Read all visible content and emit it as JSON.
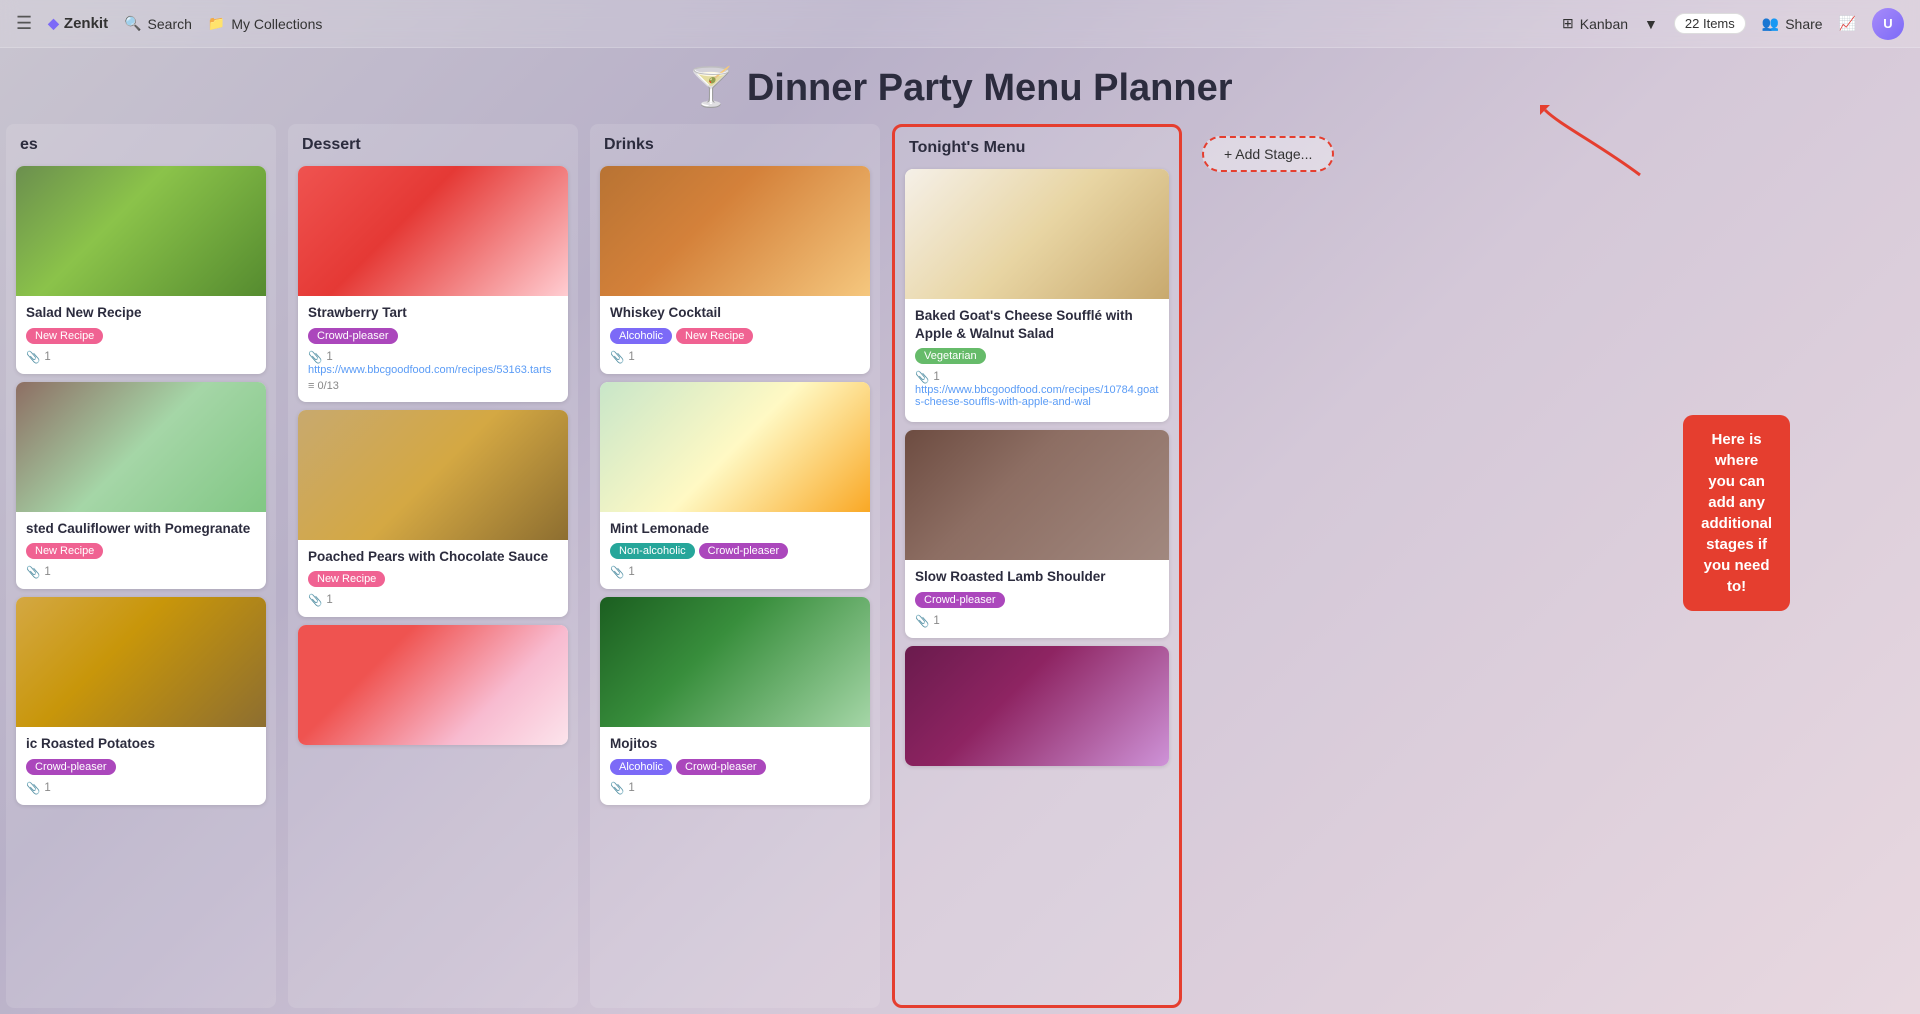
{
  "app": {
    "name": "Zenkit",
    "logo_icon": "◆"
  },
  "topnav": {
    "hamburger": "☰",
    "search_label": "Search",
    "collections_label": "My Collections",
    "view_kanban": "Kanban",
    "items_count": "22 Items",
    "share_label": "Share",
    "activity_icon": "📈"
  },
  "page": {
    "title": "Dinner Party Menu Planner",
    "title_icon": "🍸"
  },
  "columns": [
    {
      "id": "partial",
      "header": "es",
      "cards": [
        {
          "id": "salad",
          "title": "Salad New Recipe",
          "tags": [
            {
              "label": "New Recipe",
              "class": "tag-new-recipe"
            }
          ],
          "attachment_count": "1",
          "img_class": "img-salad"
        },
        {
          "id": "cauliflower",
          "title": "sted Cauliflower with Pomegranate",
          "tags": [
            {
              "label": "New Recipe",
              "class": "tag-new-recipe"
            }
          ],
          "attachment_count": "1",
          "img_class": "img-cauliflower"
        },
        {
          "id": "potatoes",
          "title": "ic Roasted Potatoes",
          "tags": [
            {
              "label": "Crowd-pleaser",
              "class": "tag-crowd-pleaser"
            }
          ],
          "attachment_count": "1",
          "img_class": "img-potatoes"
        }
      ]
    },
    {
      "id": "dessert",
      "header": "Dessert",
      "cards": [
        {
          "id": "strawberry-tart",
          "title": "Strawberry Tart",
          "tags": [
            {
              "label": "Crowd-pleaser",
              "class": "tag-crowd-pleaser"
            }
          ],
          "attachment_count": "1",
          "link": "https://www.bbcgoodfood.com/recipes/53163.tarts",
          "checklist": "0/13",
          "img_class": "img-strawberry-tart"
        },
        {
          "id": "poached-pears",
          "title": "Poached Pears with Chocolate Sauce",
          "tags": [
            {
              "label": "New Recipe",
              "class": "tag-new-recipe"
            }
          ],
          "attachment_count": "1",
          "img_class": "img-poached-pears"
        },
        {
          "id": "dessert3",
          "title": "",
          "tags": [],
          "attachment_count": "",
          "img_class": "img-dessert3"
        }
      ]
    },
    {
      "id": "drinks",
      "header": "Drinks",
      "cards": [
        {
          "id": "whiskey",
          "title": "Whiskey Cocktail",
          "tags": [
            {
              "label": "Alcoholic",
              "class": "tag-alcoholic"
            },
            {
              "label": "New Recipe",
              "class": "tag-new-recipe"
            }
          ],
          "attachment_count": "1",
          "img_class": "img-whiskey"
        },
        {
          "id": "lemonade",
          "title": "Mint Lemonade",
          "tags": [
            {
              "label": "Non-alcoholic",
              "class": "tag-non-alcoholic"
            },
            {
              "label": "Crowd-pleaser",
              "class": "tag-crowd-pleaser"
            }
          ],
          "attachment_count": "1",
          "img_class": "img-lemonade"
        },
        {
          "id": "mojito",
          "title": "Mojitos",
          "tags": [
            {
              "label": "Alcoholic",
              "class": "tag-alcoholic"
            },
            {
              "label": "Crowd-pleaser",
              "class": "tag-crowd-pleaser"
            }
          ],
          "attachment_count": "1",
          "img_class": "img-mojito"
        }
      ]
    },
    {
      "id": "tonights-menu",
      "header": "Tonight's Menu",
      "cards": [
        {
          "id": "goat-cheese",
          "title": "Baked Goat's Cheese Soufflé with Apple & Walnut Salad",
          "tags": [
            {
              "label": "Vegetarian",
              "class": "tag-vegetarian"
            }
          ],
          "attachment_count": "1",
          "link": "https://www.bbcgoodfood.com/recipes/10784.goats-cheese-souffls-with-apple-and-wal",
          "img_class": "img-goat-cheese"
        },
        {
          "id": "lamb",
          "title": "Slow Roasted Lamb Shoulder",
          "tags": [
            {
              "label": "Crowd-pleaser",
              "class": "tag-crowd-pleaser"
            }
          ],
          "attachment_count": "1",
          "img_class": "img-lamb"
        },
        {
          "id": "radicchio",
          "title": "",
          "tags": [],
          "attachment_count": "",
          "img_class": "img-radicchio"
        }
      ]
    }
  ],
  "add_stage": {
    "label": "+ Add Stage..."
  },
  "annotation": {
    "text": "Here is where you can add any additional stages if you need to!"
  }
}
